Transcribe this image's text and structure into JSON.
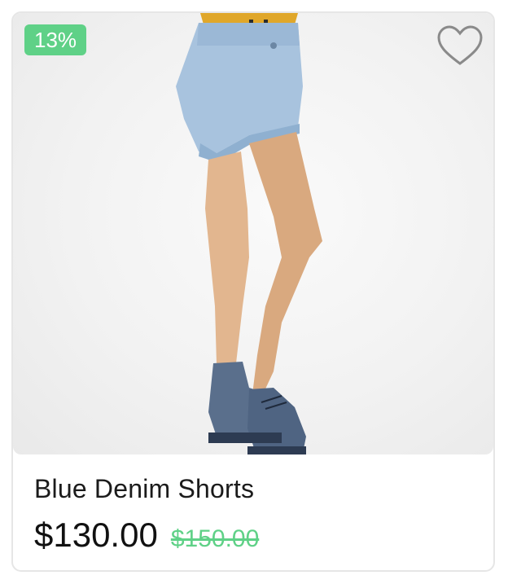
{
  "product": {
    "discount_badge": "13%",
    "title": "Blue Denim Shorts",
    "price": "$130.00",
    "original_price": "$150.00",
    "favorite_icon": "heart-outline-icon"
  },
  "colors": {
    "accent_green": "#5fd187",
    "heart_outline": "#8a8a8a",
    "card_border": "#e6e6e6"
  }
}
